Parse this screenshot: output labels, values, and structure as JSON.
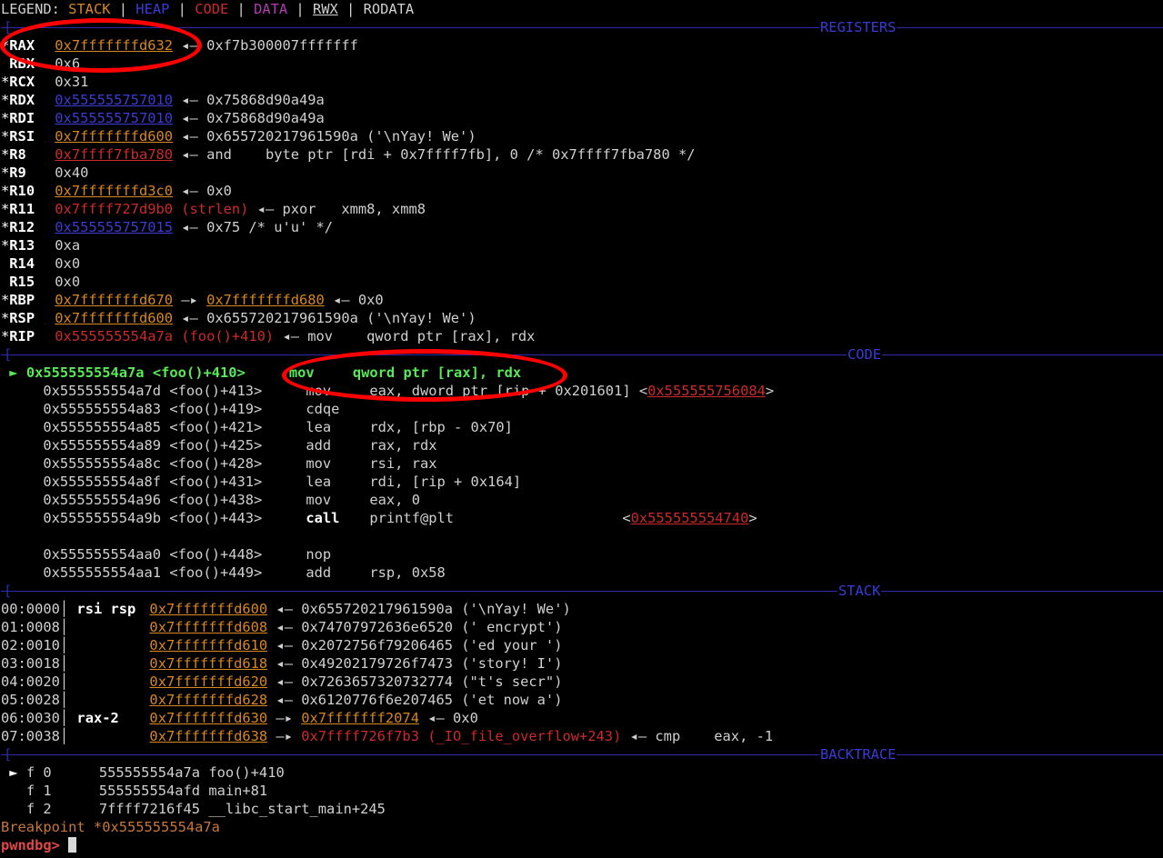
{
  "legend": {
    "prefix": "LEGEND: ",
    "stack": "STACK",
    "sep": " | ",
    "heap": "HEAP",
    "code": "CODE",
    "data": "DATA",
    "rwx": "RWX",
    "rodata": "RODATA"
  },
  "sections": {
    "registers": "REGISTERS",
    "code": "CODE",
    "stack": "STACK",
    "backtrace": "BACKTRACE"
  },
  "registers": [
    {
      "mark": "*",
      "name": "RAX",
      "addr": "0x7fffffffd632",
      "addr_color": "stack",
      "rest": " ◂— 0xf7b300007fffffff"
    },
    {
      "mark": " ",
      "name": "RBX",
      "value": "0x6"
    },
    {
      "mark": "*",
      "name": "RCX",
      "value": "0x31"
    },
    {
      "mark": "*",
      "name": "RDX",
      "addr": "0x555555757010",
      "addr_color": "heap",
      "rest": " ◂— 0x75868d90a49a"
    },
    {
      "mark": "*",
      "name": "RDI",
      "addr": "0x555555757010",
      "addr_color": "heap",
      "rest": " ◂— 0x75868d90a49a"
    },
    {
      "mark": "*",
      "name": "RSI",
      "addr": "0x7fffffffd600",
      "addr_color": "stack",
      "rest": " ◂— 0x655720217961590a ('\\nYay! We')"
    },
    {
      "mark": "*",
      "name": "R8",
      "addr": "0x7ffff7fba780",
      "addr_color": "code",
      "rest": " ◂— and    byte ptr [rdi + 0x7ffff7fb], 0 /* 0x7ffff7fba780 */"
    },
    {
      "mark": "*",
      "name": "R9",
      "value": "0x40"
    },
    {
      "mark": "*",
      "name": "R10",
      "addr": "0x7fffffffd3c0",
      "addr_color": "stack",
      "rest": " ◂— 0x0"
    },
    {
      "mark": "*",
      "name": "R11",
      "addr": "0x7ffff727d9b0 (strlen)",
      "addr_color": "codeplain",
      "rest": " ◂— pxor   xmm8, xmm8"
    },
    {
      "mark": "*",
      "name": "R12",
      "addr": "0x555555757015",
      "addr_color": "heap",
      "rest": " ◂— 0x75 /* u'u' */"
    },
    {
      "mark": "*",
      "name": "R13",
      "value": "0xa"
    },
    {
      "mark": " ",
      "name": "R14",
      "value": "0x0"
    },
    {
      "mark": " ",
      "name": "R15",
      "value": "0x0"
    },
    {
      "mark": "*",
      "name": "RBP",
      "addr": "0x7fffffffd670",
      "addr_color": "stack",
      "mid": " —▸ ",
      "addr2": "0x7fffffffd680",
      "rest": " ◂— 0x0"
    },
    {
      "mark": "*",
      "name": "RSP",
      "addr": "0x7fffffffd600",
      "addr_color": "stack",
      "rest": " ◂— 0x655720217961590a ('\\nYay! We')"
    },
    {
      "mark": "*",
      "name": "RIP",
      "addr": "0x555555554a7a (foo()+410)",
      "addr_color": "codeplain",
      "rest": " ◂— mov    qword ptr [rax], rdx"
    }
  ],
  "code": {
    "current": {
      "arrow": "►",
      "addr": "0x555555554a7a",
      "sym": "<foo()+410>",
      "mnem": "mov",
      "ops": "qword ptr [rax], rdx"
    },
    "lines": [
      {
        "addr": "0x555555554a7d",
        "sym": "<foo()+413>",
        "mnem": "mov",
        "ops": "eax, dword ptr [rip + 0x201601] <",
        "target": "0x555555756084",
        "tail": ">"
      },
      {
        "addr": "0x555555554a83",
        "sym": "<foo()+419>",
        "mnem": "cdqe",
        "ops": ""
      },
      {
        "addr": "0x555555554a85",
        "sym": "<foo()+421>",
        "mnem": "lea",
        "ops": "rdx, [rbp - 0x70]"
      },
      {
        "addr": "0x555555554a89",
        "sym": "<foo()+425>",
        "mnem": "add",
        "ops": "rax, rdx"
      },
      {
        "addr": "0x555555554a8c",
        "sym": "<foo()+428>",
        "mnem": "mov",
        "ops": "rsi, rax"
      },
      {
        "addr": "0x555555554a8f",
        "sym": "<foo()+431>",
        "mnem": "lea",
        "ops": "rdi, [rip + 0x164]"
      },
      {
        "addr": "0x555555554a96",
        "sym": "<foo()+438>",
        "mnem": "mov",
        "ops": "eax, 0"
      },
      {
        "addr": "0x555555554a9b",
        "sym": "<foo()+443>",
        "mnem": "call",
        "ops": "printf@plt                    <",
        "target": "0x555555554740",
        "tail": ">"
      },
      {
        "blank": true
      },
      {
        "addr": "0x555555554aa0",
        "sym": "<foo()+448>",
        "mnem": "nop",
        "ops": ""
      },
      {
        "addr": "0x555555554aa1",
        "sym": "<foo()+449>",
        "mnem": "add",
        "ops": "rsp, 0x58"
      }
    ]
  },
  "stack": [
    {
      "off": "00:0000",
      "tag": "rsi rsp",
      "addr": "0x7fffffffd600",
      "rest": " ◂— 0x655720217961590a ('\\nYay! We')"
    },
    {
      "off": "01:0008",
      "tag": "",
      "addr": "0x7fffffffd608",
      "rest": " ◂— 0x74707972636e6520 (' encrypt')"
    },
    {
      "off": "02:0010",
      "tag": "",
      "addr": "0x7fffffffd610",
      "rest": " ◂— 0x2072756f79206465 ('ed your ')"
    },
    {
      "off": "03:0018",
      "tag": "",
      "addr": "0x7fffffffd618",
      "rest": " ◂— 0x49202179726f7473 ('story! I')"
    },
    {
      "off": "04:0020",
      "tag": "",
      "addr": "0x7fffffffd620",
      "rest": " ◂— 0x7263657320732774 (\"t's secr\")"
    },
    {
      "off": "05:0028",
      "tag": "",
      "addr": "0x7fffffffd628",
      "rest": " ◂— 0x6120776f6e207465 ('et now a')"
    },
    {
      "off": "06:0030",
      "tag": "rax-2",
      "addr": "0x7fffffffd630",
      "mid": " —▸ ",
      "addr2": "0x7fffffff2074",
      "rest": " ◂— 0x0"
    },
    {
      "off": "07:0038",
      "tag": "",
      "addr": "0x7fffffffd638",
      "mid": " —▸ ",
      "code": "0x7ffff726f7b3 (_IO_file_overflow+243)",
      "rest": " ◂— cmp    eax, -1"
    }
  ],
  "backtrace": [
    {
      "arrow": "►",
      "frame": "f 0",
      "addr": "555555554a7a",
      "sym": "foo()+410"
    },
    {
      "arrow": " ",
      "frame": "f 1",
      "addr": "555555554afd",
      "sym": "main+81"
    },
    {
      "arrow": " ",
      "frame": "f 2",
      "addr": "7ffff7216f45",
      "sym": "__libc_start_main+245"
    }
  ],
  "breakpoint": "Breakpoint *0x555555554a7a",
  "prompt": "pwndbg>",
  "colors": {
    "stack": "#d7871f",
    "heap": "#3b3bd6",
    "code": "#cc2a2a",
    "data": "#b23ab2",
    "annotation": "#ff0000"
  }
}
